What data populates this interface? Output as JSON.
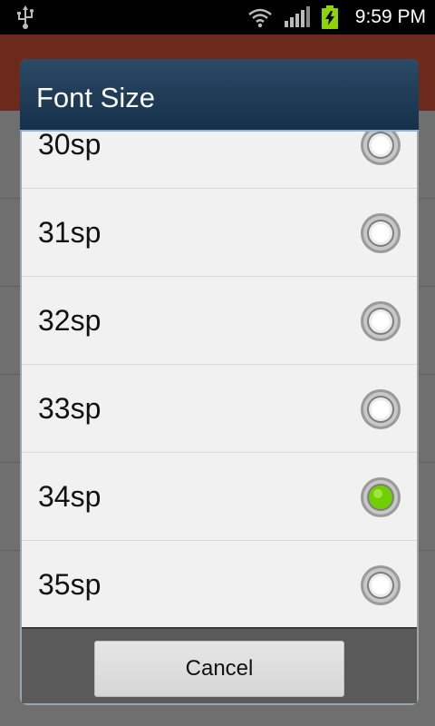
{
  "status_bar": {
    "time": "9:59 PM",
    "icons": [
      "usb-icon",
      "wifi-icon",
      "signal-icon",
      "battery-charging-icon"
    ],
    "battery_color": "#8fd400"
  },
  "dialog": {
    "title": "Font Size",
    "options": [
      {
        "label": "30sp",
        "selected": false
      },
      {
        "label": "31sp",
        "selected": false
      },
      {
        "label": "32sp",
        "selected": false
      },
      {
        "label": "33sp",
        "selected": false
      },
      {
        "label": "34sp",
        "selected": true
      },
      {
        "label": "35sp",
        "selected": false
      }
    ],
    "cancel_label": "Cancel",
    "selected_color": "#6fcf00"
  }
}
